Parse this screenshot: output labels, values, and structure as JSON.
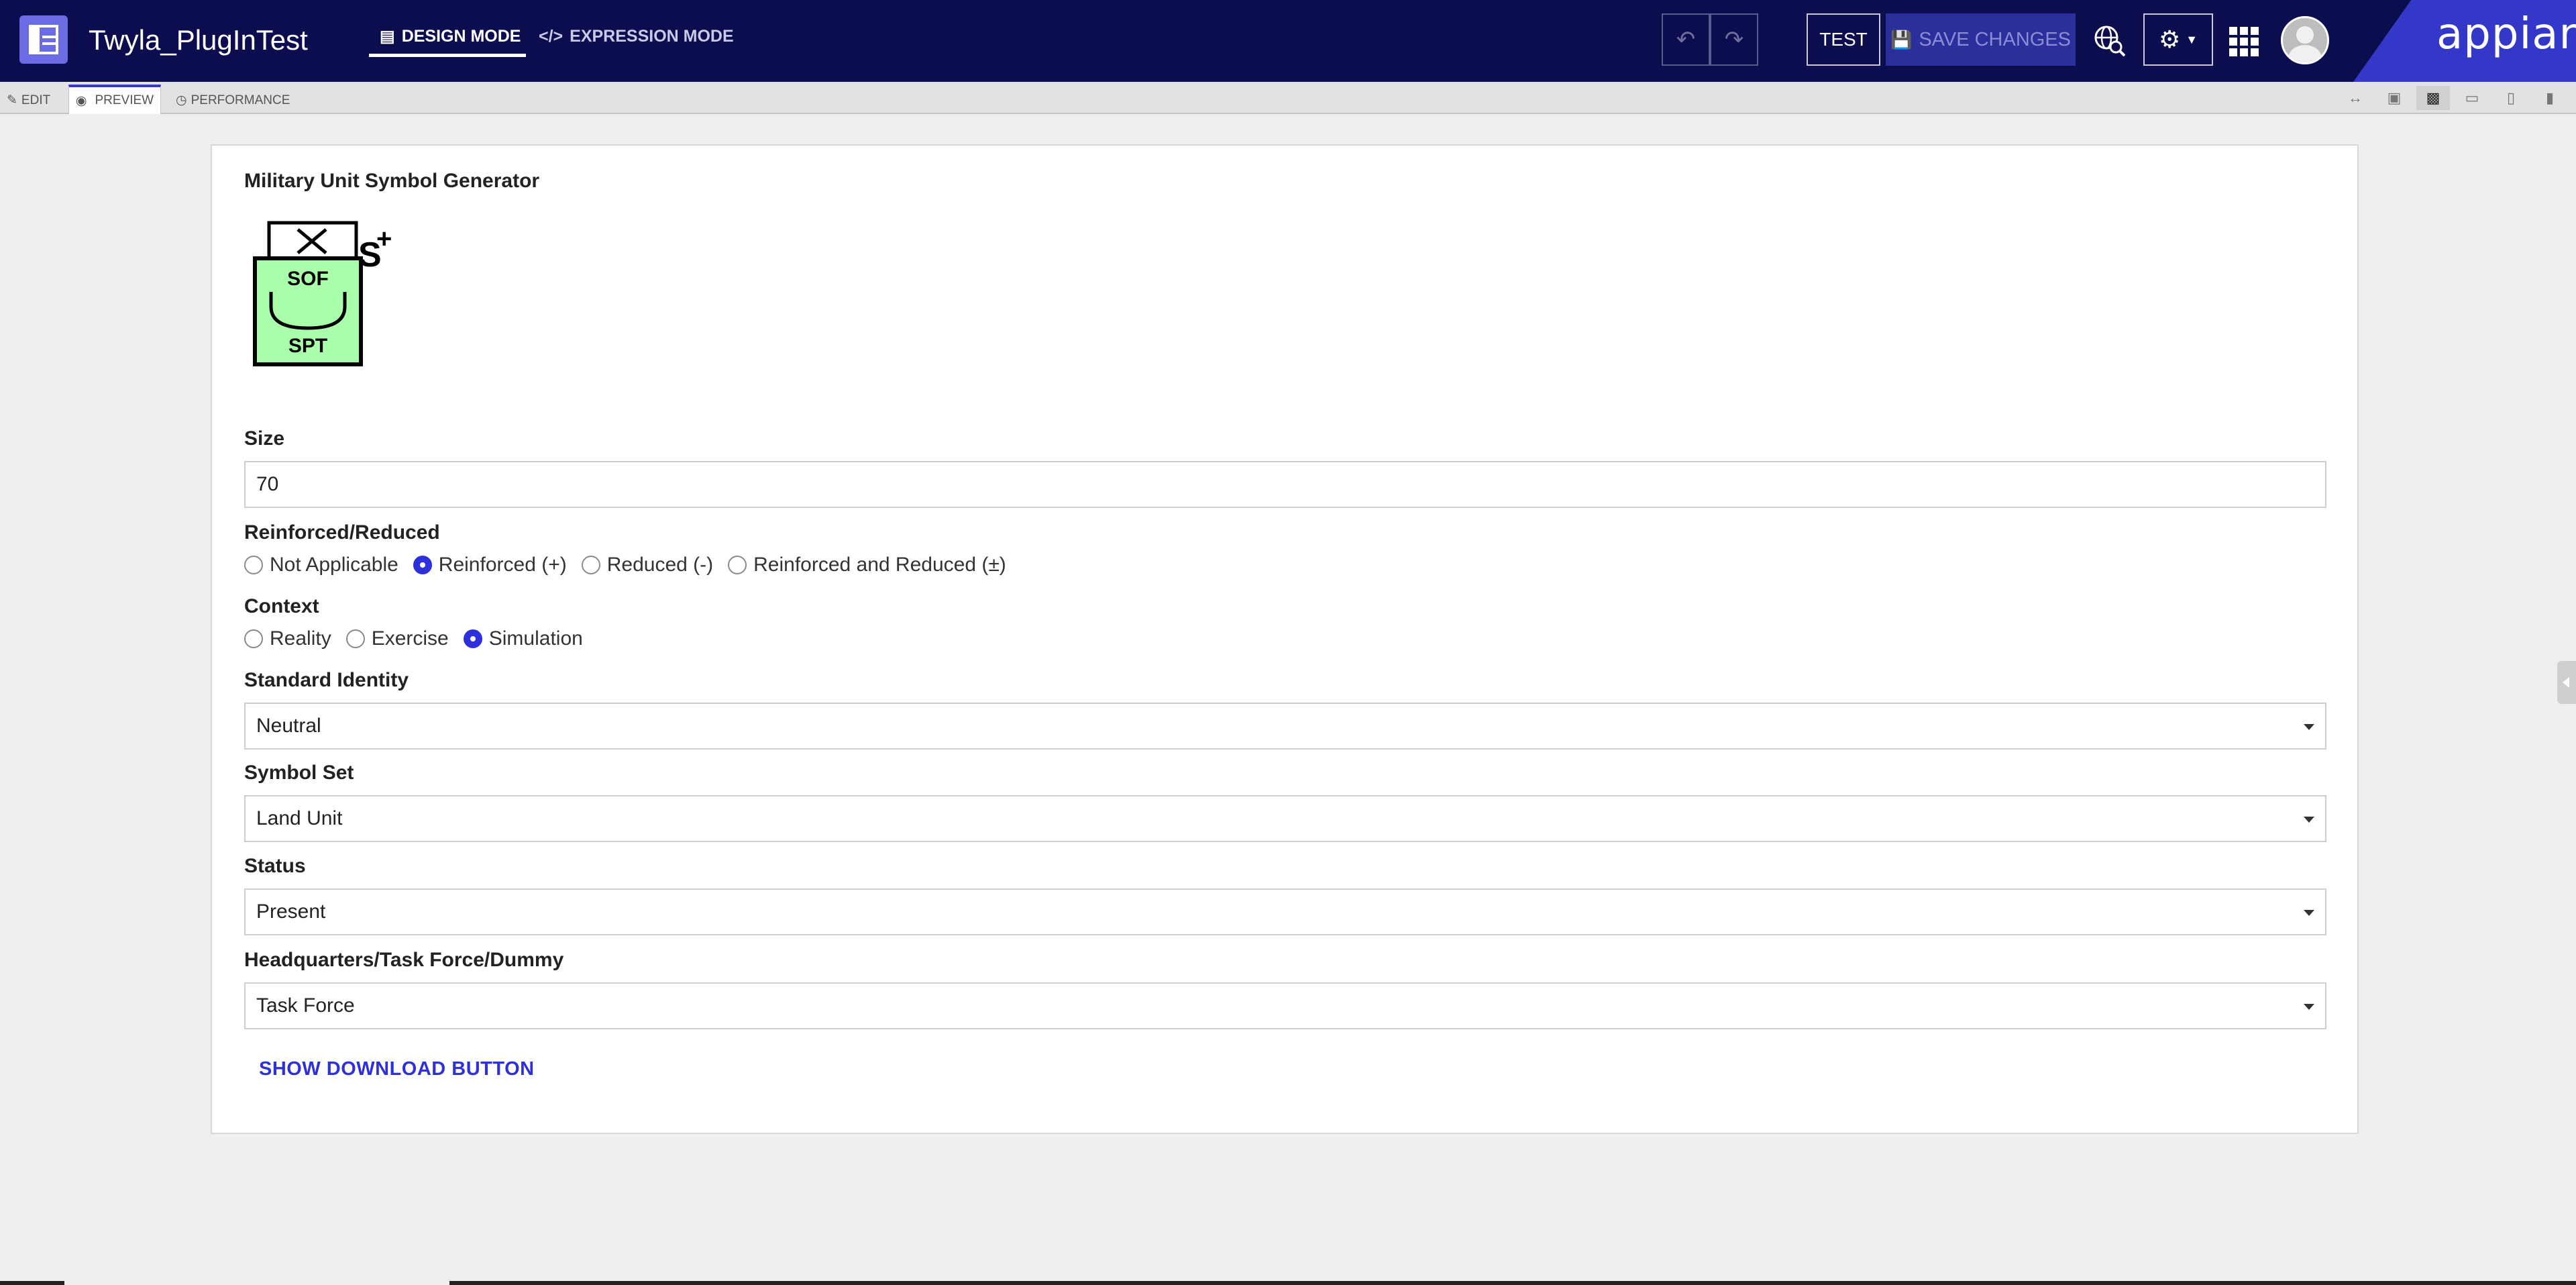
{
  "header": {
    "app_title": "Twyla_PlugInTest",
    "modes": {
      "design": "DESIGN MODE",
      "expression": "EXPRESSION MODE"
    },
    "buttons": {
      "test": "TEST",
      "save_changes": "SAVE CHANGES"
    },
    "brand": "appian"
  },
  "subbar": {
    "tabs": {
      "edit": "EDIT",
      "preview": "PREVIEW",
      "performance": "PERFORMANCE"
    }
  },
  "form": {
    "title": "Military Unit Symbol Generator",
    "symbol": {
      "top_text": "SOF",
      "bottom_text": "SPT",
      "modifier": "S",
      "reinforced_mark": "+",
      "fill_color": "#aaffaa"
    },
    "size": {
      "label": "Size",
      "value": "70"
    },
    "reinforced": {
      "label": "Reinforced/Reduced",
      "options": [
        "Not Applicable",
        "Reinforced (+)",
        "Reduced (-)",
        "Reinforced and Reduced (±)"
      ],
      "selected": "Reinforced (+)"
    },
    "context": {
      "label": "Context",
      "options": [
        "Reality",
        "Exercise",
        "Simulation"
      ],
      "selected": "Simulation"
    },
    "standard_identity": {
      "label": "Standard Identity",
      "value": "Neutral"
    },
    "symbol_set": {
      "label": "Symbol Set",
      "value": "Land Unit"
    },
    "status": {
      "label": "Status",
      "value": "Present"
    },
    "hq_tf_dummy": {
      "label": "Headquarters/Task Force/Dummy",
      "value": "Task Force"
    },
    "download_link": "SHOW DOWNLOAD BUTTON"
  },
  "colors": {
    "header_bg": "#0c0d4e",
    "accent": "#2e31d9",
    "brand_bg": "#3338c9"
  }
}
